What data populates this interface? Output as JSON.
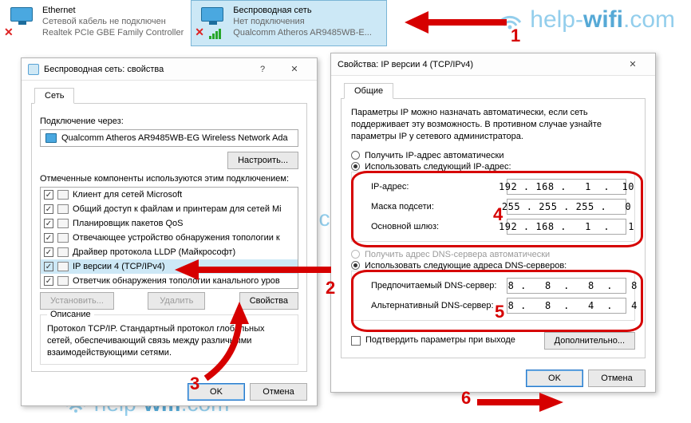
{
  "adapters": [
    {
      "name": "Ethernet",
      "sub1": "Сетевой кабель не подключен",
      "sub2": "Realtek PCIe GBE Family Controller"
    },
    {
      "name": "Беспроводная сеть",
      "sub1": "Нет подключения",
      "sub2": "Qualcomm Atheros AR9485WB-E..."
    }
  ],
  "watermark_prefix": "help-",
  "watermark_accent": "wifi",
  "watermark_suffix": ".com",
  "dlg1": {
    "title": "Беспроводная сеть: свойства",
    "tab": "Сеть",
    "connect_via_label": "Подключение через:",
    "adapter": "Qualcomm Atheros AR9485WB-EG Wireless Network Ada",
    "configure_btn": "Настроить...",
    "components_label": "Отмеченные компоненты используются этим подключением:",
    "items": [
      "Клиент для сетей Microsoft",
      "Общий доступ к файлам и принтерам для сетей Mi",
      "Планировщик пакетов QoS",
      "Отвечающее устройство обнаружения топологии к",
      "Драйвер протокола LLDP (Майкрософт)",
      "IP версии 4 (TCP/IPv4)",
      "Ответчик обнаружения топологии канального уров"
    ],
    "install_btn": "Установить...",
    "remove_btn": "Удалить",
    "props_btn": "Свойства",
    "desc_title": "Описание",
    "desc": "Протокол TCP/IP. Стандартный протокол глобальных сетей, обеспечивающий связь между различными взаимодействующими сетями.",
    "ok": "OK",
    "cancel": "Отмена"
  },
  "dlg2": {
    "title": "Свойства: IP версии 4 (TCP/IPv4)",
    "tab": "Общие",
    "intro": "Параметры IP можно назначать автоматически, если сеть поддерживает эту возможность. В противном случае узнайте параметры IP у сетевого администратора.",
    "r_auto": "Получить IP-адрес автоматически",
    "r_man": "Использовать следующий IP-адрес:",
    "ip_label": "IP-адрес:",
    "ip": "192 . 168 .   1  .  10",
    "mask_label": "Маска подсети:",
    "mask": "255 . 255 . 255 .   0",
    "gw_label": "Основной шлюз:",
    "gw": "192 . 168 .   1  .   1",
    "r_dns_auto": "Получить адрес DNS-сервера автоматически",
    "r_dns_man": "Использовать следующие адреса DNS-серверов:",
    "dns1_label": "Предпочитаемый DNS-сервер:",
    "dns1": "  8 .   8  .   8  .   8",
    "dns2_label": "Альтернативный DNS-сервер:",
    "dns2": "  8 .   8  .   4  .   4",
    "validate": "Подтвердить параметры при выходе",
    "advanced": "Дополнительно...",
    "ok": "OK",
    "cancel": "Отмена"
  },
  "callouts": {
    "1": "1",
    "2": "2",
    "3": "3",
    "4": "4",
    "5": "5",
    "6": "6"
  }
}
